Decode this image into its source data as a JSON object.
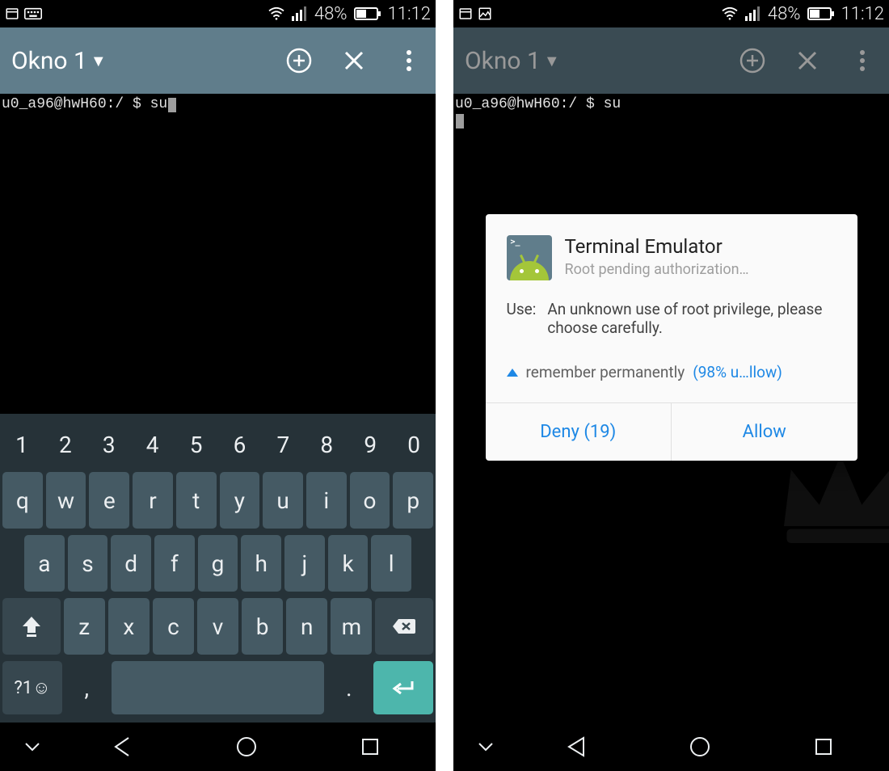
{
  "status": {
    "battery_pct": "48%",
    "time": "11:12"
  },
  "appbar": {
    "tab_label": "Okno 1"
  },
  "terminal": {
    "prompt_left": "u0_a96@hwH60:/ $ su"
  },
  "keyboard": {
    "numbers": [
      "1",
      "2",
      "3",
      "4",
      "5",
      "6",
      "7",
      "8",
      "9",
      "0"
    ],
    "row1": [
      "q",
      "w",
      "e",
      "r",
      "t",
      "y",
      "u",
      "i",
      "o",
      "p"
    ],
    "row2": [
      "a",
      "s",
      "d",
      "f",
      "g",
      "h",
      "j",
      "k",
      "l"
    ],
    "row3": [
      "z",
      "x",
      "c",
      "v",
      "b",
      "n",
      "m"
    ],
    "sym_label": "?1☺",
    "comma": ",",
    "period": "."
  },
  "dialog": {
    "title": "Terminal Emulator",
    "subtitle": "Root pending authorization…",
    "use_label": "Use:",
    "use_text": "An unknown use of root privilege, please choose carefully.",
    "remember_label": "remember permanently",
    "remember_hint": "(98% u…llow)",
    "deny_label": "Deny (19)",
    "allow_label": "Allow"
  }
}
